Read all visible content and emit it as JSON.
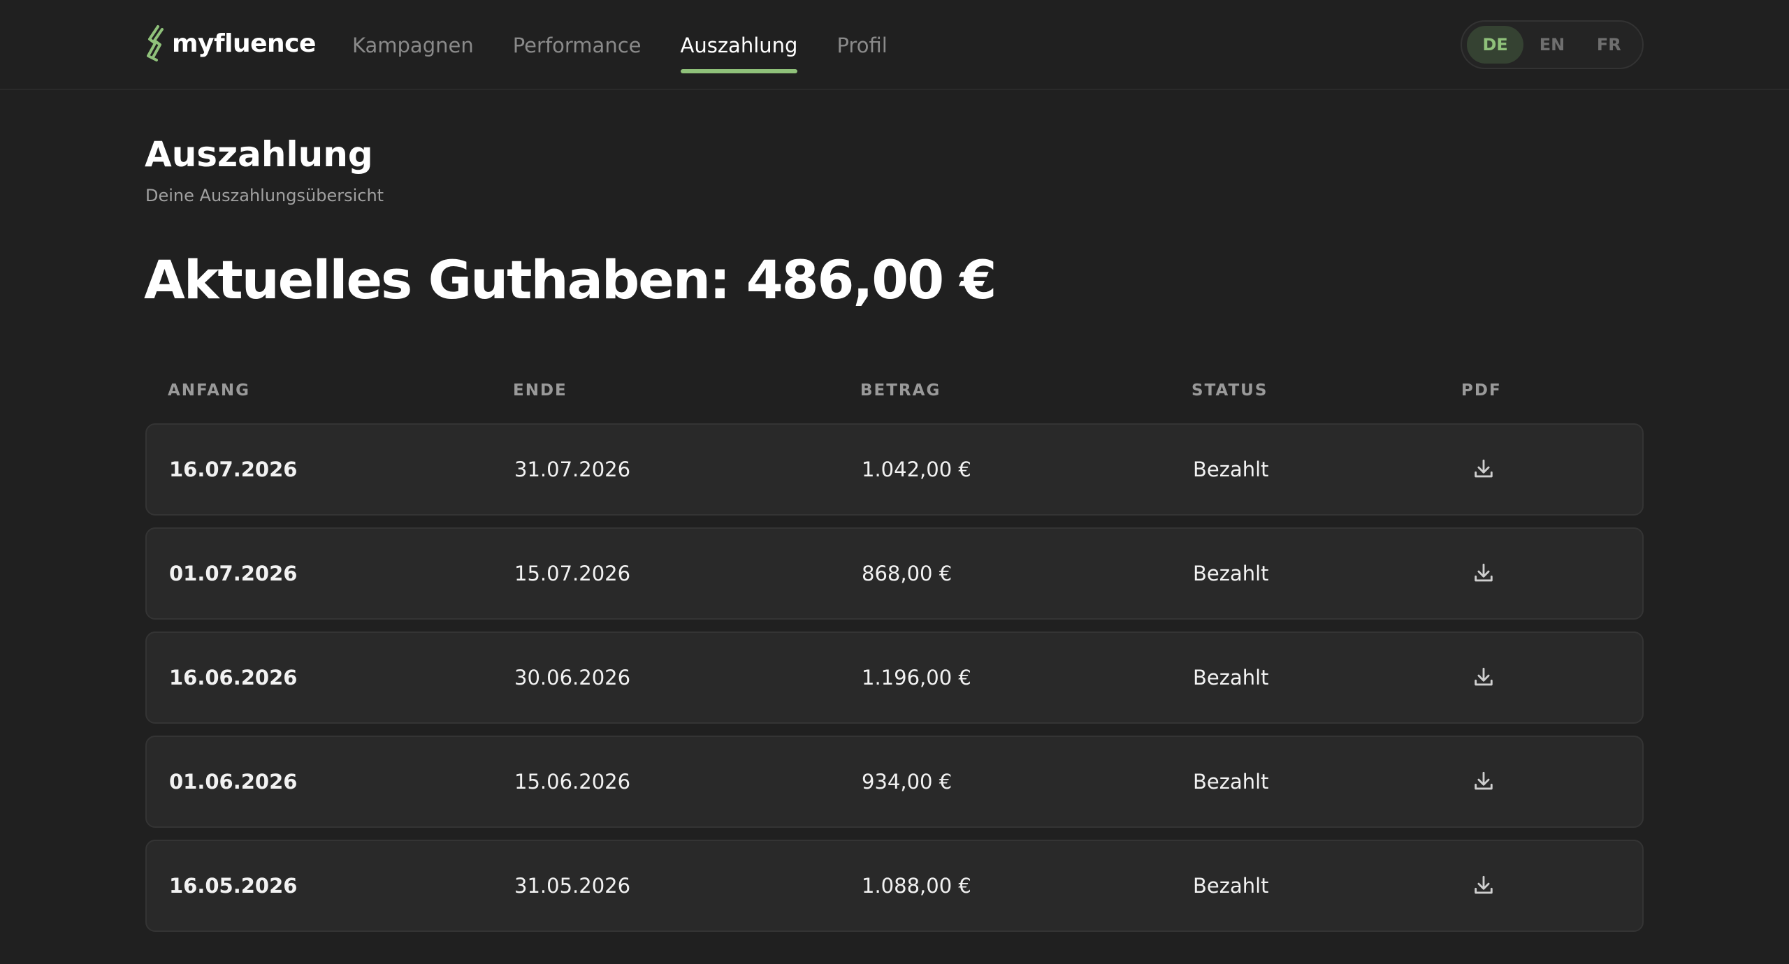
{
  "brand": {
    "name": "myfluence",
    "accent_color": "#8fc17a"
  },
  "nav": {
    "items": [
      {
        "label": "Kampagnen",
        "active": false
      },
      {
        "label": "Performance",
        "active": false
      },
      {
        "label": "Auszahlung",
        "active": true
      },
      {
        "label": "Profil",
        "active": false
      }
    ]
  },
  "language": {
    "options": [
      "DE",
      "EN",
      "FR"
    ],
    "selected": "DE"
  },
  "page": {
    "title": "Auszahlung",
    "subtitle": "Deine Auszahlungsübersicht",
    "balance": "Aktuelles Guthaben: 486,00 €"
  },
  "table": {
    "headers": {
      "start": "ANFANG",
      "end": "ENDE",
      "amount": "BETRAG",
      "status": "STATUS",
      "pdf": "PDF"
    },
    "rows": [
      {
        "start": "16.07.2026",
        "end": "31.07.2026",
        "amount": "1.042,00 €",
        "status": "Bezahlt",
        "pdf_icon": "download-icon"
      },
      {
        "start": "01.07.2026",
        "end": "15.07.2026",
        "amount": "868,00 €",
        "status": "Bezahlt",
        "pdf_icon": "download-icon"
      },
      {
        "start": "16.06.2026",
        "end": "30.06.2026",
        "amount": "1.196,00 €",
        "status": "Bezahlt",
        "pdf_icon": "download-icon"
      },
      {
        "start": "01.06.2026",
        "end": "15.06.2026",
        "amount": "934,00 €",
        "status": "Bezahlt",
        "pdf_icon": "download-icon"
      },
      {
        "start": "16.05.2026",
        "end": "31.05.2026",
        "amount": "1.088,00 €",
        "status": "Bezahlt",
        "pdf_icon": "download-icon"
      }
    ]
  }
}
